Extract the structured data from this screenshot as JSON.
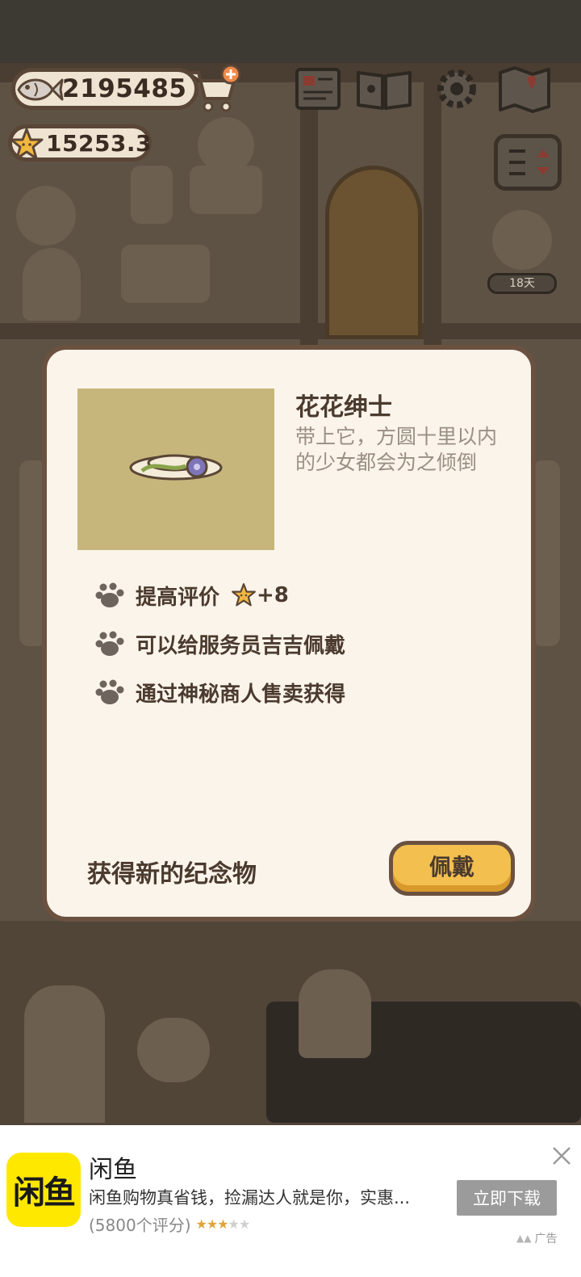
{
  "hud": {
    "fish_count": "2195485",
    "star_count": "15253.3",
    "days_badge": "18天"
  },
  "modal": {
    "title": "花花绅士",
    "description": "带上它，方圆十里以内的少女都会为之倾倒",
    "features": [
      {
        "text": "提高评价",
        "bonus": "+8"
      },
      {
        "text": "可以给服务员吉吉佩戴"
      },
      {
        "text": "通过神秘商人售卖获得"
      }
    ],
    "footer_note": "获得新的纪念物",
    "equip_label": "佩戴"
  },
  "ad": {
    "logo_text": "闲鱼",
    "title": "闲鱼",
    "description": "闲鱼购物真省钱，捡漏达人就是你，实惠...",
    "rating_text": "(5800个评分)",
    "rating_stars": 3,
    "cta_label": "立即下载",
    "ad_label": "广告"
  },
  "colors": {
    "accent_yellow": "#f3c04f",
    "modal_border": "#6b5140",
    "modal_bg": "#fbf4ea",
    "text_dark": "#4b3a2e",
    "ad_logo_bg": "#ffe800"
  },
  "icons": [
    "fish-icon",
    "cart-plus-icon",
    "star-icon",
    "notebook-icon",
    "paw-book-icon",
    "gear-icon",
    "map-icon",
    "menu-toggle-icon",
    "paw-icon",
    "close-icon"
  ]
}
